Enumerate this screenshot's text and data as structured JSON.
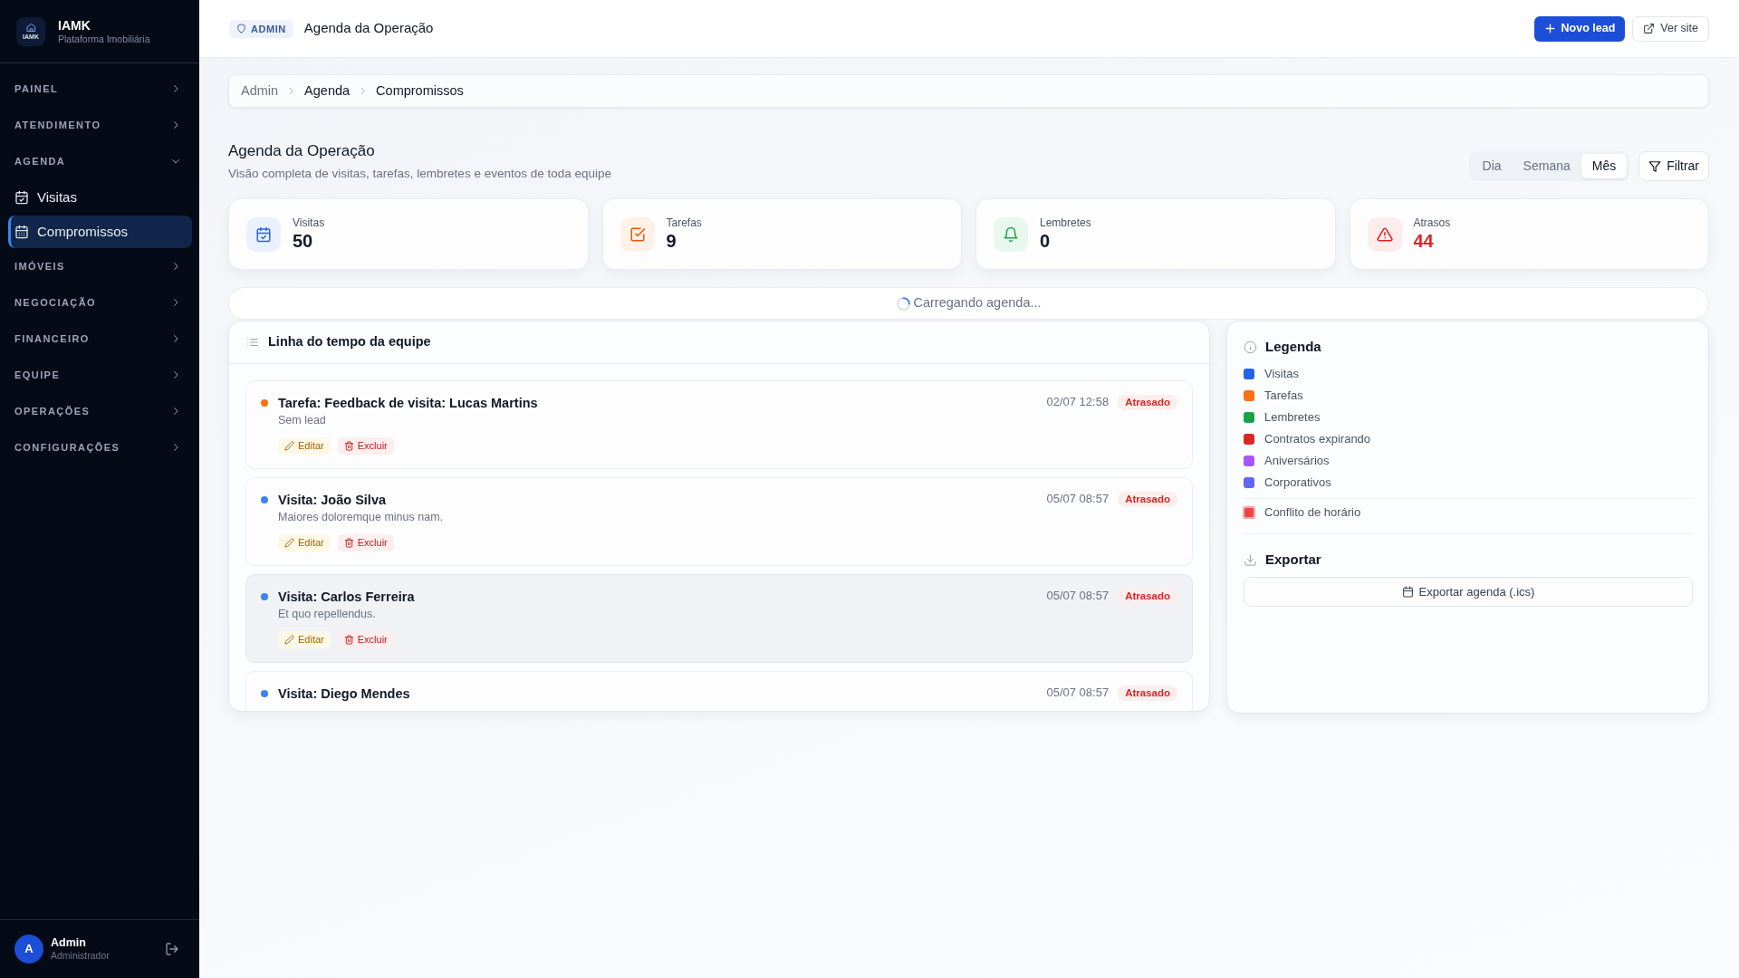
{
  "sidebar": {
    "brand": {
      "logo_text": "IAMK",
      "name": "IAMK",
      "tagline": "Plataforma Imobiliária"
    },
    "sections": [
      {
        "label": "PAINEL",
        "expanded": false
      },
      {
        "label": "ATENDIMENTO",
        "expanded": false
      },
      {
        "label": "AGENDA",
        "expanded": true,
        "children": [
          {
            "label": "Visitas",
            "kind": "calendar-check",
            "selected": false
          },
          {
            "label": "Compromissos",
            "kind": "calendar-grid",
            "selected": true
          }
        ]
      },
      {
        "label": "IMÓVEIS",
        "expanded": false
      },
      {
        "label": "NEGOCIAÇÃO",
        "expanded": false
      },
      {
        "label": "FINANCEIRO",
        "expanded": false
      },
      {
        "label": "EQUIPE",
        "expanded": false
      },
      {
        "label": "OPERAÇÕES",
        "expanded": false
      },
      {
        "label": "CONFIGURAÇÕES",
        "expanded": false
      }
    ],
    "user": {
      "initial": "A",
      "name": "Admin",
      "role": "Administrador"
    }
  },
  "topbar": {
    "badge": "ADMIN",
    "title": "Agenda da Operação",
    "buttons": [
      {
        "label": "Novo lead",
        "kind": "primary"
      },
      {
        "label": "Ver site",
        "kind": "external"
      }
    ]
  },
  "breadcrumb": [
    {
      "label": "Admin",
      "muted": true
    },
    {
      "label": "Agenda",
      "muted": false
    },
    {
      "label": "Compromissos",
      "muted": false
    }
  ],
  "page_header": {
    "title": "Agenda da Operação",
    "subtitle": "Visão completa de visitas, tarefas, lembretes e eventos de toda equipe",
    "views": [
      {
        "label": "Dia",
        "selected": false
      },
      {
        "label": "Semana",
        "selected": false
      },
      {
        "label": "Mês",
        "selected": true
      }
    ],
    "filter_button": "Filtrar"
  },
  "stats": [
    {
      "label": "Visitas",
      "value": "50",
      "kind": "calendar",
      "alert": false
    },
    {
      "label": "Tarefas",
      "value": "9",
      "kind": "checkbox",
      "alert": false
    },
    {
      "label": "Lembretes",
      "value": "0",
      "kind": "bell",
      "alert": false
    },
    {
      "label": "Atrasos",
      "value": "44",
      "kind": "warning",
      "alert": true
    }
  ],
  "loading": {
    "text": "Carregando agenda..."
  },
  "timeline": {
    "title": "Linha do tempo da equipe",
    "items": [
      {
        "title": "Tarefa: Feedback de visita: Lucas Martins",
        "subtitle": "Sem lead",
        "time": "02/07 12:58",
        "status": "Atrasado",
        "color": "#f97316",
        "hovered": false,
        "actions": [
          {
            "label": "Editar",
            "kind": "edit"
          },
          {
            "label": "Excluir",
            "kind": "delete"
          }
        ]
      },
      {
        "title": "Visita: João Silva",
        "subtitle": "Maiores doloremque minus nam.",
        "time": "05/07 08:57",
        "status": "Atrasado",
        "color": "#3b82f6",
        "hovered": false,
        "actions": [
          {
            "label": "Editar",
            "kind": "edit"
          },
          {
            "label": "Excluir",
            "kind": "delete"
          }
        ]
      },
      {
        "title": "Visita: Carlos Ferreira",
        "subtitle": "Et quo repellendus.",
        "time": "05/07 08:57",
        "status": "Atrasado",
        "color": "#3b82f6",
        "hovered": true,
        "actions": [
          {
            "label": "Editar",
            "kind": "edit"
          },
          {
            "label": "Excluir",
            "kind": "delete"
          }
        ]
      },
      {
        "title": "Visita: Diego Mendes",
        "time": "05/07 08:57",
        "status": "Atrasado",
        "color": "#3b82f6",
        "hovered": false
      }
    ]
  },
  "legend": {
    "title": "Legenda",
    "items": [
      {
        "label": "Visitas",
        "color": "#2563eb"
      },
      {
        "label": "Tarefas",
        "color": "#f97316"
      },
      {
        "label": "Lembretes",
        "color": "#16a34a"
      },
      {
        "label": "Contratos expirando",
        "color": "#dc2626"
      },
      {
        "label": "Aniversários",
        "color": "#a855f7"
      },
      {
        "label": "Corporativos",
        "color": "#6366f1"
      }
    ],
    "conflict": {
      "label": "Conflito de horário",
      "color": "#ef4444"
    }
  },
  "export": {
    "title": "Exportar",
    "button": "Exportar agenda (.ics)"
  }
}
